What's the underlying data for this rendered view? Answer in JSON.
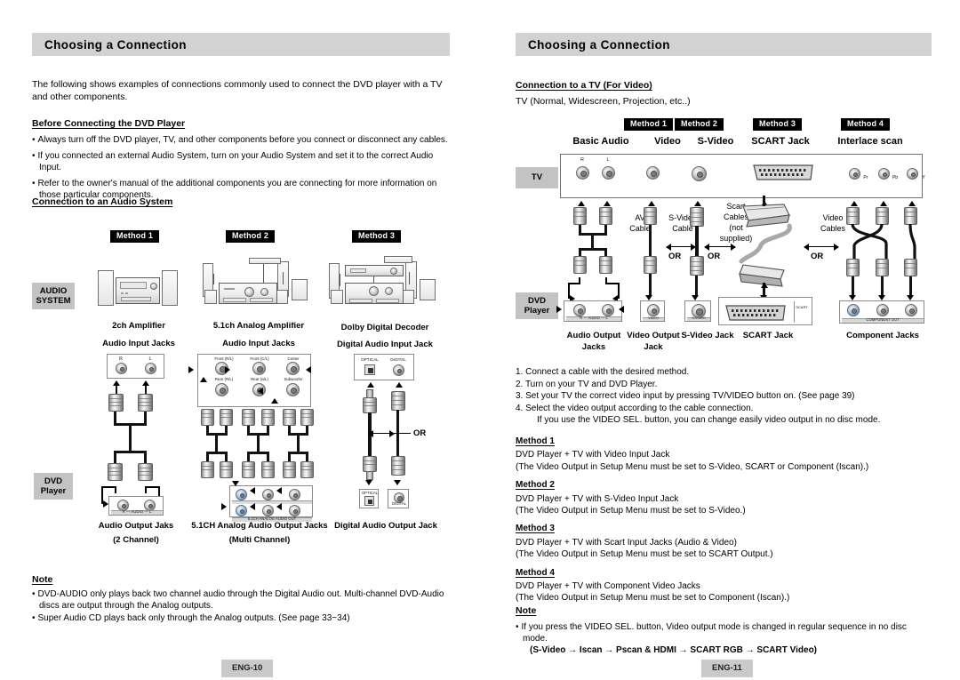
{
  "left_page": {
    "header": {
      "title": "Choosing a Connection"
    },
    "intro": "The following shows examples of connections commonly used to connect the DVD player with a TV and other components.",
    "before_heading": "Before Connecting the DVD Player",
    "before_bullets": [
      "Always turn off the DVD player, TV, and other components before you connect or disconnect any cables.",
      "If you connected an external Audio System, turn on your Audio System and set it to the correct Audio Input.",
      "Refer to the owner's manual of the additional components you are connecting for more information on those particular components."
    ],
    "audio_heading": "Connection to an Audio System",
    "method_badges": [
      "Method 1",
      "Method 2",
      "Method 3"
    ],
    "side_labels": {
      "audio_system": [
        "AUDIO",
        "SYSTEM"
      ],
      "dvd_player": [
        "DVD",
        "Player"
      ]
    },
    "device_captions": [
      {
        "name": "2ch Amplifier",
        "jacks": "Audio Input Jacks"
      },
      {
        "name": "5.1ch Analog Amplifier",
        "jacks": "Audio Input Jacks"
      },
      {
        "name": "Dolby Digital Decoder",
        "jacks": "Digital Audio Input Jack"
      }
    ],
    "output_captions": [
      {
        "line1": "Audio Output Jaks",
        "line2": "(2 Channel)"
      },
      {
        "line1": "5.1CH Analog Audio Output Jacks",
        "line2": "(Multi Channel)"
      },
      {
        "line1": "Digital Audio Output Jack",
        "line2": ""
      }
    ],
    "jack_labels": {
      "rl": [
        "R",
        "L"
      ],
      "analog_in": [
        "Front (R/L)",
        "Front (C/L)",
        "Center",
        "Rear (R/L)",
        "Rear (a/L)",
        "Subwoofer"
      ],
      "digital": [
        "OPTICAL",
        "DIGITAL"
      ],
      "audio_out_strip": "R --- AUDIO --- L",
      "analog_out_strip": "5.1CH ANALOG AUDIO OUT"
    },
    "or_label": "OR",
    "note": {
      "title": "Note",
      "bullets": [
        "DVD-AUDIO only plays back two channel audio through the Digital Audio out. Multi-channel DVD-Audio discs are output through the Analog outputs.",
        "Super Audio CD plays back only through the Analog outputs. (See page 33~34)"
      ]
    },
    "page_number": "ENG-10"
  },
  "right_page": {
    "header": {
      "title": "Choosing a Connection"
    },
    "tv_heading": "Connection to a TV (For Video)",
    "tv_subtitle": "TV (Normal, Widescreen, Projection, etc..)",
    "method_badges": [
      "Method 1",
      "Method 2",
      "Method 3",
      "Method 4"
    ],
    "column_headers": [
      "Basic Audio",
      "Video",
      "S-Video",
      "SCART Jack",
      "Interlace scan"
    ],
    "side_labels": {
      "tv": "TV",
      "dvd_player": [
        "DVD",
        "Player"
      ]
    },
    "cable_labels": [
      {
        "line1": "AV",
        "line2": "Cable"
      },
      {
        "line1": "S-Video",
        "line2": "Cable"
      },
      {
        "line1": "Scart",
        "line2": "Cables",
        "line3": "(not",
        "line4": "supplied)"
      },
      {
        "line1": "Video",
        "line2": "Cables"
      }
    ],
    "or_labels": [
      "OR",
      "OR",
      "OR"
    ],
    "jack_captions": [
      {
        "line1": "Audio Output",
        "line2": "Jacks"
      },
      {
        "line1": "Video Output",
        "line2": "Jack"
      },
      {
        "line1": "S-Video Jack",
        "line2": ""
      },
      {
        "line1": "SCART Jack",
        "line2": ""
      },
      {
        "line1": "Component Jacks",
        "line2": ""
      }
    ],
    "tv_jack_labels": {
      "rl": [
        "R",
        "L"
      ],
      "component": [
        "Pr",
        "Pb",
        "Y"
      ]
    },
    "dvd_jack_strips": {
      "audio": "R --- AUDIO --- L",
      "video": "VIDEO",
      "svideo": "S-VIDEO",
      "component": "COMPONENT OUT"
    },
    "steps": [
      "Connect a cable with the desired method.",
      "Turn on your TV and DVD Player.",
      "Set your TV the correct video input by pressing TV/VIDEO button on. (See page 39)",
      "Select the video output according to the cable connection."
    ],
    "step4_sub": "If you use the VIDEO SEL. button, you can change easily video output in no disc mode.",
    "methods": [
      {
        "title": "Method 1",
        "line1": "DVD Player + TV with Video Input Jack",
        "line2": "(The Video Output in Setup Menu must be set to S-Video, SCART or Component (Iscan).)"
      },
      {
        "title": "Method 2",
        "line1": "DVD Player + TV with S-Video Input Jack",
        "line2": "(The Video Output in Setup Menu must be set to S-Video.)"
      },
      {
        "title": "Method 3",
        "line1": "DVD Player + TV with Scart Input Jacks (Audio & Video)",
        "line2": "(The Video Output in Setup Menu must be set to SCART Output.)"
      },
      {
        "title": "Method 4",
        "line1": "DVD Player + TV with Component Video Jacks",
        "line2": "(The Video Output in Setup Menu must be set to Component (Iscan).)"
      }
    ],
    "note": {
      "title": "Note",
      "bullet": "If you press the VIDEO SEL. button, Video output mode is changed in regular sequence in no disc mode.",
      "sequence": "(S-Video → Iscan → Pscan & HDMI → SCART RGB → SCART Video)"
    },
    "page_number": "ENG-11"
  },
  "colors": {
    "header_band": "#d2d2d2",
    "side_label_bg": "#c3c3c3",
    "badge_bg": "#000000",
    "badge_text": "#ffffff",
    "page_number_bg": "#c9c9c9"
  }
}
